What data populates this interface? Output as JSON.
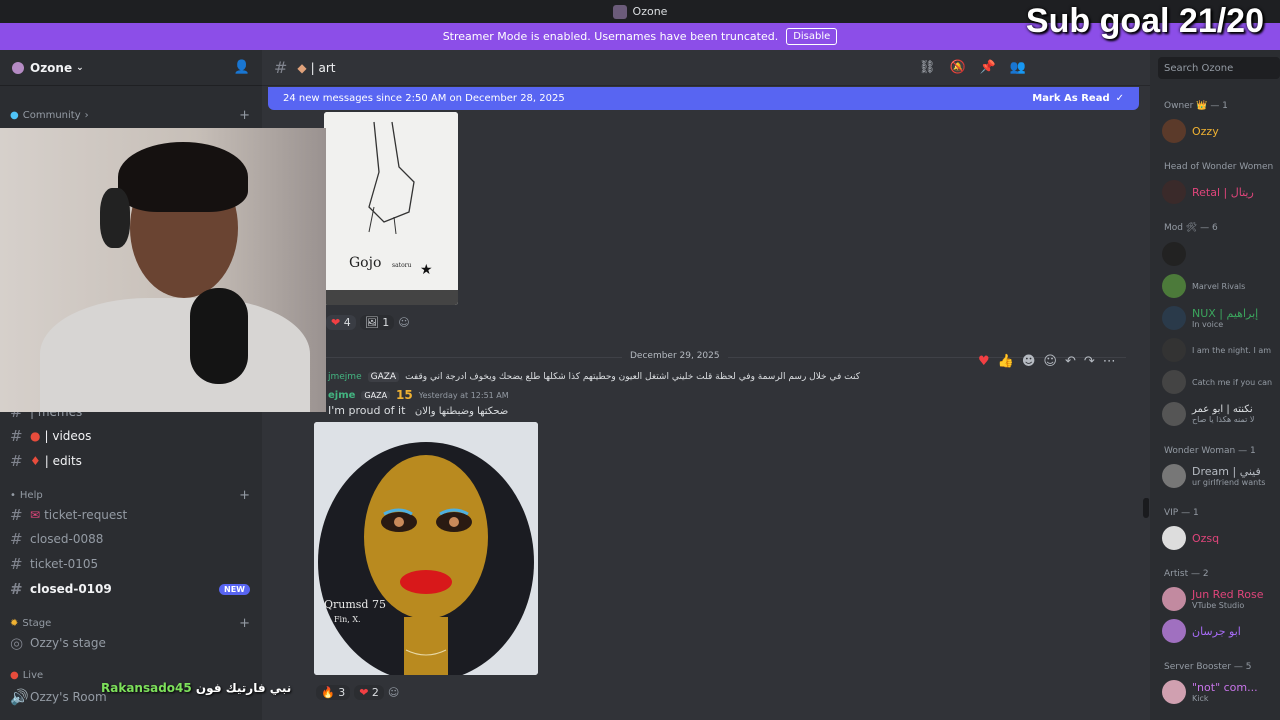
{
  "titlebar": {
    "title": "Ozone"
  },
  "overlay": {
    "sub_goal": "Sub goal 21/20",
    "viewer_name": "Rakansado45",
    "viewer_message": "نبي فارتيك فون"
  },
  "banner": {
    "text": "Streamer Mode is enabled. Usernames have been truncated.",
    "button": "Disable"
  },
  "server": {
    "name": "Ozone"
  },
  "sidebar": {
    "categories": [
      {
        "label": "Community",
        "top": 0
      },
      {
        "label": "Help"
      },
      {
        "label": "Stage"
      },
      {
        "label": "Live"
      }
    ],
    "channels": [
      {
        "label": "| memes"
      },
      {
        "label": "| videos"
      },
      {
        "label": "| edits"
      },
      {
        "label": "ticket-request"
      },
      {
        "label": "closed-0088"
      },
      {
        "label": "ticket-0105"
      },
      {
        "label": "closed-0109",
        "badge": "NEW"
      },
      {
        "label": "Ozzy's stage"
      },
      {
        "label": "Ozzy's Room"
      }
    ]
  },
  "channel": {
    "name": "| art"
  },
  "new_messages": {
    "text": "24 new messages since 2:50 AM on December 28, 2025",
    "mark_label": "Mark As Read"
  },
  "search": {
    "placeholder": "Search Ozone"
  },
  "messages": {
    "reactions1": [
      {
        "emoji": "❤",
        "count": "4"
      },
      {
        "emoji": "🖼",
        "count": "1"
      }
    ],
    "date_separator": "December 29, 2025",
    "reply_user": "jmejme",
    "reply_tag": "GAZA",
    "reply_text": "كنت في خلال رسم الرسمة وفي لحظة قلت خليني اشتغل العيون وحطيتهم كذا شكلها طلع يضحك ويخوف ادرجة اني وقفت",
    "author": "ejme",
    "author_tag": "GAZA",
    "level": "15",
    "timestamp": "Yesterday at 12:51 AM",
    "text": "I'm proud of it",
    "text_ar": "ضحكتها وضبطتها والان",
    "reactions2": [
      {
        "emoji": "🔥",
        "count": "3"
      },
      {
        "emoji": "❤",
        "count": "2"
      }
    ]
  },
  "members": {
    "groups": [
      {
        "label": "Owner 👑 — 1"
      },
      {
        "label": "Head of Wonder Women"
      },
      {
        "label": "Mod 🛠 — 6"
      },
      {
        "label": "Wonder Woman — 1"
      },
      {
        "label": "VIP — 1"
      },
      {
        "label": "Artist — 2"
      },
      {
        "label": "Server Booster — 5"
      }
    ],
    "list": [
      {
        "name": "Ozzy",
        "status": "",
        "color": "#f0b232"
      },
      {
        "name": "Retal | ريتال",
        "status": "",
        "color": "#e0457b"
      },
      {
        "name": "",
        "status": "Marvel Rivals",
        "color": "#b5bac1"
      },
      {
        "name": "NUX | إبراهيم",
        "status": "In voice",
        "color": "#3ba55d"
      },
      {
        "name": "",
        "status": "I am the night. I am",
        "color": "#b5bac1"
      },
      {
        "name": "",
        "status": "Catch me if you can",
        "color": "#b5bac1"
      },
      {
        "name": "نكنته | ابو عمر",
        "status": "لا تمنه هكذا يا صاح",
        "color": "#dbdee1"
      },
      {
        "name": "Dream | فيني",
        "status": "ur girlfriend wants",
        "color": "#b5bac1"
      },
      {
        "name": "Ozsq",
        "status": "",
        "color": "#e0457b"
      },
      {
        "name": "Jun Red Rose",
        "status": "VTube Studio",
        "color": "#e0457b"
      },
      {
        "name": "ابو جرسان",
        "status": "",
        "color": "#a66bf5"
      },
      {
        "name": "\"not\" com...",
        "status": "Kick",
        "color": "#c774e8"
      }
    ]
  }
}
